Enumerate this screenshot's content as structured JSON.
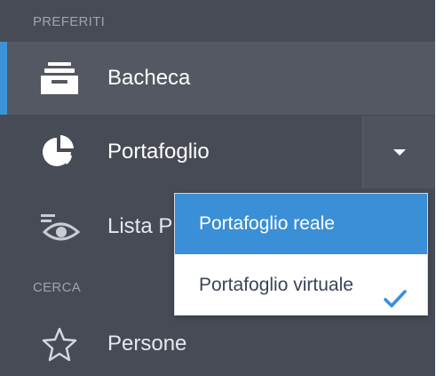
{
  "sections": {
    "favorites": "PREFERITI",
    "search": "CERCA"
  },
  "nav": {
    "dashboard": {
      "label": "Bacheca",
      "icon": "inbox-tray-icon"
    },
    "portfolio": {
      "label": "Portafoglio",
      "icon": "pie-chart-icon"
    },
    "watchlist": {
      "label": "Lista P",
      "icon": "eye-icon"
    },
    "people": {
      "label": "Persone",
      "icon": "star-icon"
    }
  },
  "portfolio_dropdown": {
    "toggle_icon": "caret-down-icon",
    "options": [
      {
        "label": "Portafoglio reale",
        "highlighted": true,
        "checked": false
      },
      {
        "label": "Portafoglio virtuale",
        "highlighted": false,
        "checked": true
      }
    ],
    "check_icon": "checkmark-icon"
  },
  "colors": {
    "sidebar_bg": "#474b56",
    "active_row_bg": "#545862",
    "accent": "#3d93d8",
    "highlight": "#3b8fd6",
    "check": "#3a8edb",
    "section_header": "#9ea3ae",
    "menu_text": "#3b4356"
  }
}
